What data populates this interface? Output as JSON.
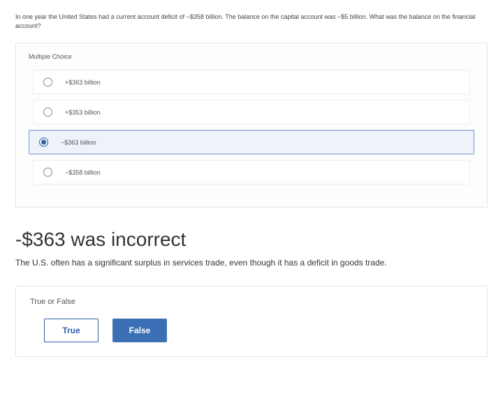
{
  "question": "In one year the United States had a current account deficit of −$358 billion. The balance on the capital account was −$5 billion. What was the balance on the financial account?",
  "mc": {
    "title": "Multiple Choice",
    "options": [
      {
        "label": "+$363 billion",
        "selected": false
      },
      {
        "label": "+$353 billion",
        "selected": false
      },
      {
        "label": "−$363 billion",
        "selected": true
      },
      {
        "label": "−$358 billion",
        "selected": false
      }
    ]
  },
  "feedback": {
    "heading": "-$363 was incorrect",
    "text": "The U.S. often has a significant surplus in services trade, even though it has a deficit in goods trade."
  },
  "tf": {
    "title": "True or False",
    "true_label": "True",
    "false_label": "False"
  }
}
